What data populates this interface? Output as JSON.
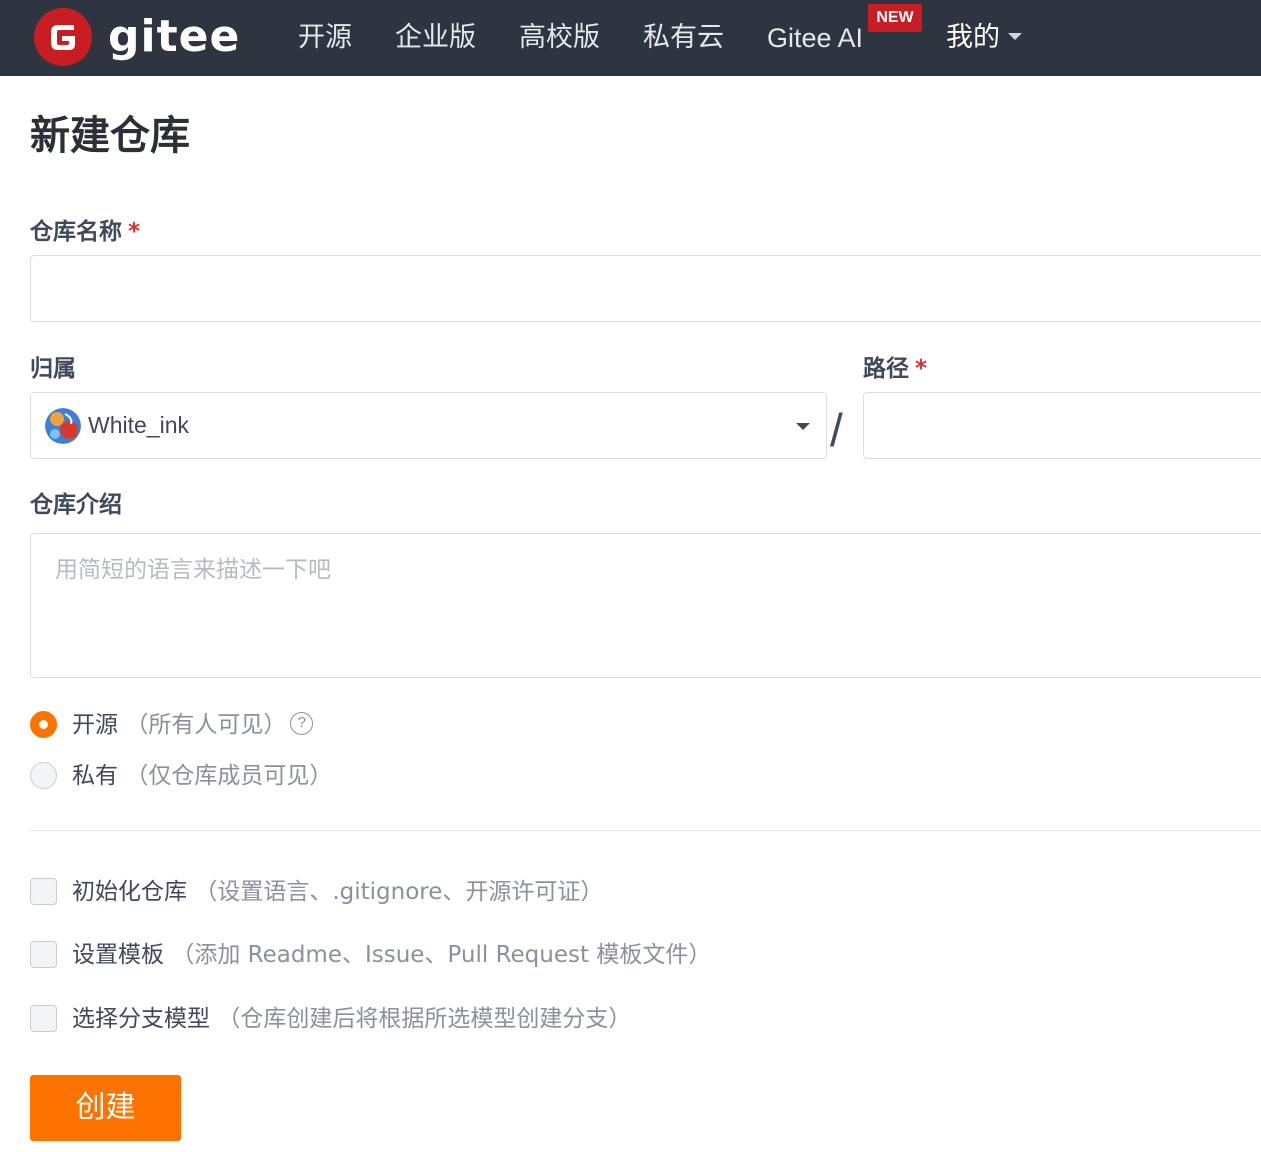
{
  "nav": {
    "logo_text": "gitee",
    "items": [
      "开源",
      "企业版",
      "高校版",
      "私有云",
      "Gitee AI"
    ],
    "new_badge": "NEW",
    "mine": "我的",
    "colors": {
      "background": "#2e3440",
      "brand_red": "#c71d23"
    }
  },
  "page": {
    "title": "新建仓库"
  },
  "form": {
    "repo_name": {
      "label": "仓库名称",
      "required_mark": "*",
      "value": ""
    },
    "owner": {
      "label": "归属",
      "value": "White_ink",
      "icon": "avatar"
    },
    "path_separator": "/",
    "path": {
      "label": "路径",
      "required_mark": "*",
      "value": ""
    },
    "description": {
      "label": "仓库介绍",
      "placeholder": "用简短的语言来描述一下吧",
      "value": ""
    },
    "visibility": [
      {
        "label": "开源",
        "hint": "（所有人可见）",
        "checked": true,
        "help_icon": "?"
      },
      {
        "label": "私有",
        "hint": "（仅仓库成员可见）",
        "checked": false
      }
    ],
    "options": [
      {
        "label": "初始化仓库",
        "hint": "（设置语言、.gitignore、开源许可证）",
        "checked": false
      },
      {
        "label": "设置模板",
        "hint": "（添加 Readme、Issue、Pull Request 模板文件）",
        "checked": false
      },
      {
        "label": "选择分支模型",
        "hint": "（仓库创建后将根据所选模型创建分支）",
        "checked": false
      }
    ],
    "submit_label": "创建",
    "accent_color": "#fe7300"
  }
}
